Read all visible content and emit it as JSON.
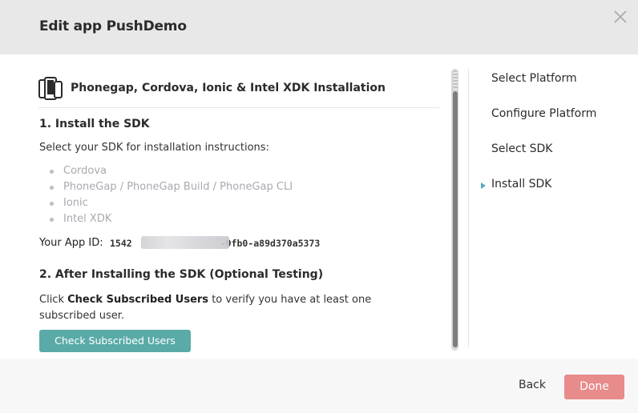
{
  "header": {
    "title": "Edit app PushDemo",
    "close_icon": "close-icon"
  },
  "section": {
    "icon": "mobile-devices-icon",
    "title": "Phonegap, Cordova, Ionic & Intel XDK Installation"
  },
  "step1": {
    "title": "1. Install the SDK",
    "instructions": "Select your SDK for installation instructions:",
    "sdk_options": [
      "Cordova",
      "PhoneGap / PhoneGap Build / PhoneGap CLI",
      "Ionic",
      "Intel XDK"
    ]
  },
  "app_id": {
    "label": "Your App ID:",
    "value_prefix": "1542",
    "value_suffix": "-9fb0-a89d370a5373"
  },
  "step2": {
    "title": "2. After Installing the SDK (Optional Testing)",
    "text_before": "Click ",
    "text_bold": "Check Subscribed Users",
    "text_after": " to verify you have at least one subscribed user.",
    "button_label": "Check Subscribed Users"
  },
  "wizard_steps": [
    {
      "label": "Select Platform"
    },
    {
      "label": "Configure Platform"
    },
    {
      "label": "Select SDK"
    },
    {
      "label": "Install SDK",
      "active": true
    }
  ],
  "footer": {
    "back_label": "Back",
    "done_label": "Done"
  },
  "colors": {
    "header_bg": "#e8e8e9",
    "teal_button": "#5aaba8",
    "done_button": "#e88b8b",
    "active_arrow": "#5aa7c5",
    "sdk_option_text": "#a9a9b0"
  }
}
